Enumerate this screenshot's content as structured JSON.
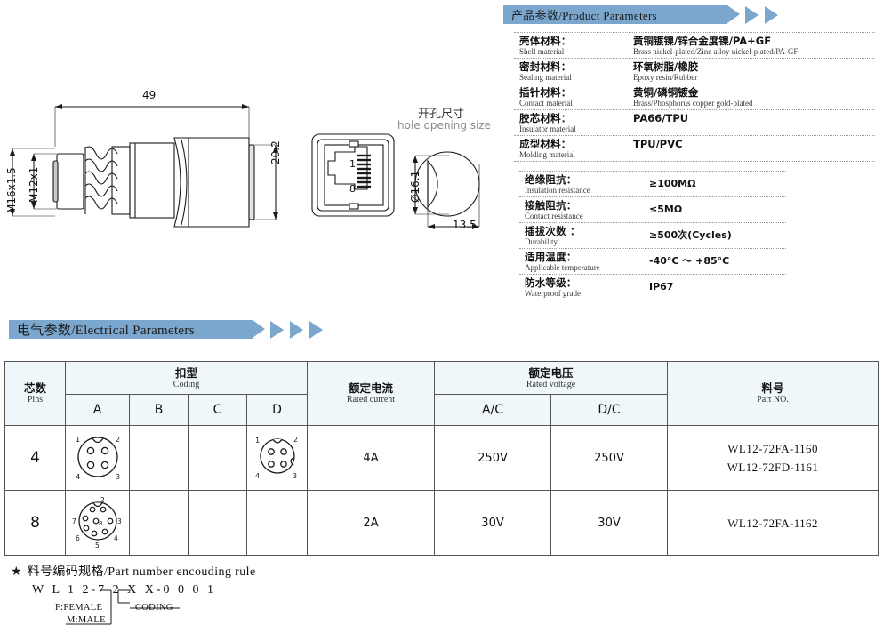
{
  "product_parameters": {
    "banner": "产品参数/Product Parameters",
    "rows": [
      {
        "cn": "壳体材料：",
        "en": "Shell material",
        "value_cn": "黄铜镀镍/锌合金度镍/PA+GF",
        "value_en": "Brass nickel-plated/Zinc alloy nickel-plated/PA-GF"
      },
      {
        "cn": "密封材料：",
        "en": "Sealing material",
        "value_cn": "环氧树脂/橡胶",
        "value_en": "Epoxy resin/Rubber"
      },
      {
        "cn": "插针材料：",
        "en": "Contact material",
        "value_cn": "黄铜/磷铜镀金",
        "value_en": "Brass/Phosphorus copper gold-plated"
      },
      {
        "cn": "胶芯材料：",
        "en": "Insulator material",
        "value_cn": "PA66/TPU",
        "value_en": ""
      },
      {
        "cn": "成型材料：",
        "en": "Molding material",
        "value_cn": "TPU/PVC",
        "value_en": ""
      }
    ],
    "specs": [
      {
        "cn": "绝缘阻抗：",
        "en": "Insulation resistance",
        "value": "≥100MΩ"
      },
      {
        "cn": "接触阻抗：",
        "en": "Contact resistance",
        "value": "≤5MΩ"
      },
      {
        "cn": "插拔次数 ：",
        "en": "Durability",
        "value": "≥500次(Cycles)"
      },
      {
        "cn": "适用温度：",
        "en": "Applicable temperature",
        "value": "-40°C ～ +85°C"
      },
      {
        "cn": "防水等级：",
        "en": "Waterproof grade",
        "value": "IP67"
      }
    ]
  },
  "drawing": {
    "length": "49",
    "height": "20.2",
    "thread_outer": "M16x1.5",
    "thread_inner": "M12x1",
    "pin_top": "1",
    "pin_bottom": "8",
    "hole_title_cn": "开孔尺寸",
    "hole_title_en": "hole opening size",
    "hole_diameter": "Ø16.1",
    "hole_width": "13.5"
  },
  "electrical": {
    "banner": "电气参数/Electrical Parameters",
    "headers": {
      "pins_cn": "芯数",
      "pins_en": "Pins",
      "coding_cn": "扣型",
      "coding_en": "Coding",
      "coding_cols": [
        "A",
        "B",
        "C",
        "D"
      ],
      "current_cn": "额定电流",
      "current_en": "Rated current",
      "voltage_cn": "额定电压",
      "voltage_en": "Rated voltage",
      "voltage_cols": [
        "A/C",
        "D/C"
      ],
      "partno_cn": "料号",
      "partno_en": "Part NO."
    },
    "rows": [
      {
        "pins": "4",
        "coding_a": true,
        "coding_b": false,
        "coding_c": false,
        "coding_d": true,
        "current": "4A",
        "voltage_ac": "250V",
        "voltage_dc": "250V",
        "part_numbers": [
          "WL12-72FA-1160",
          "WL12-72FD-1161"
        ]
      },
      {
        "pins": "8",
        "coding_a": true,
        "coding_b": false,
        "coding_c": false,
        "coding_d": false,
        "current": "2A",
        "voltage_ac": "30V",
        "voltage_dc": "30V",
        "part_numbers": [
          "WL12-72FA-1162"
        ]
      }
    ]
  },
  "encoding_rule": {
    "star": "★",
    "title": "料号编码规格/Part number encouding rule",
    "code": "W L 1 2-7 2 X X-0 0 0 1",
    "female": "F:FEMALE",
    "male": "M:MALE",
    "coding": "CODING"
  },
  "colors": {
    "banner": "#7ba7ce",
    "table_header": "#eff7fb",
    "border": "#555555"
  }
}
